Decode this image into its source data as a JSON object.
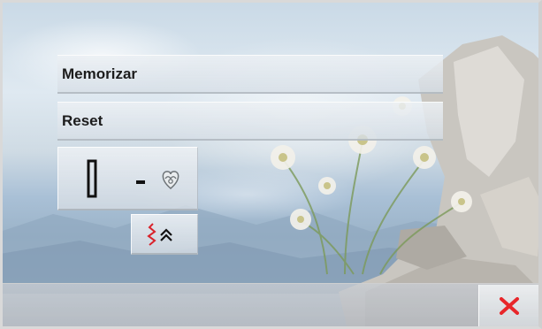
{
  "menu": {
    "memorize_label": "Memorizar",
    "reset_label": "Reset"
  },
  "tiles": {
    "assign_icon": "buttonhole-to-heart-icon",
    "stitch_icon": "stitch-pattern-up-icon"
  },
  "footer": {
    "close_icon": "close-icon"
  },
  "colors": {
    "close_red": "#e8262a",
    "stitch_red": "#d9232c",
    "text": "#1c1c1c"
  }
}
